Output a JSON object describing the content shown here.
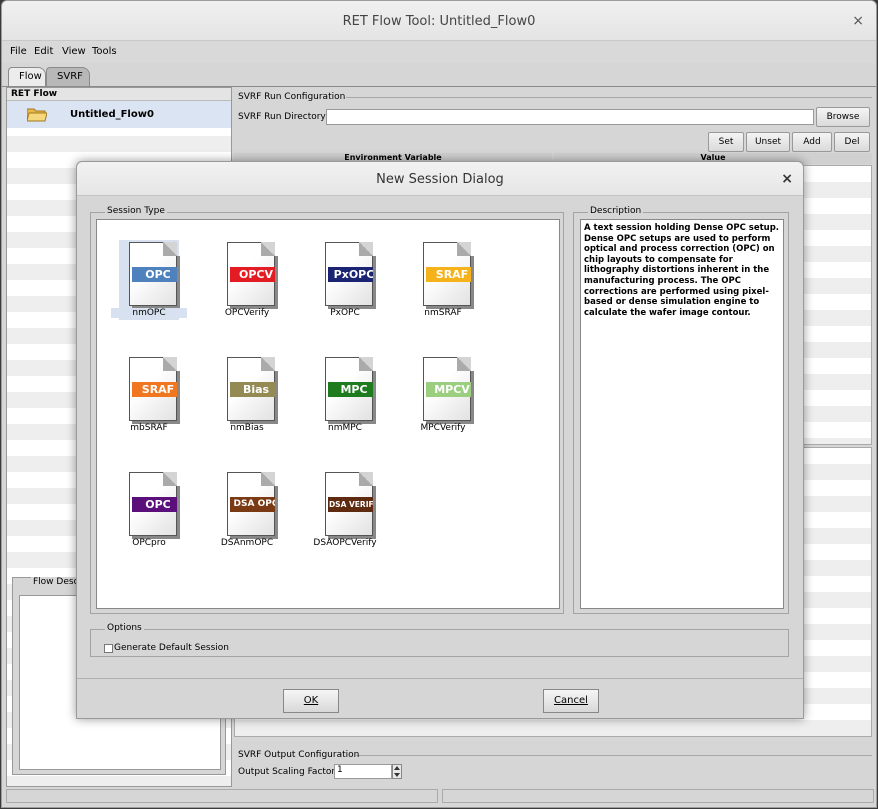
{
  "window": {
    "title": "RET Flow Tool: Untitled_Flow0",
    "close_glyph": "×"
  },
  "menu": [
    {
      "label": "File"
    },
    {
      "label": "Edit"
    },
    {
      "label": "View"
    },
    {
      "label": "Tools"
    }
  ],
  "tabs": [
    {
      "label": "Flow"
    },
    {
      "label": "SVRF"
    }
  ],
  "left": {
    "header": "RET Flow",
    "flow_item": "Untitled_Flow0",
    "flow_description_label": "Flow Descr"
  },
  "svrf_run": {
    "group_label": "SVRF Run Configuration",
    "directory_label": "SVRF Run Directory",
    "directory_value": "",
    "browse": "Browse",
    "buttons": [
      "Set",
      "Unset",
      "Add",
      "Del"
    ],
    "columns": [
      "Environment Variable",
      "Value"
    ]
  },
  "svrf_output": {
    "group_label": "SVRF Output Configuration",
    "scaling_label": "Output Scaling Factor",
    "scaling_value": "1"
  },
  "dialog": {
    "title": "New Session Dialog",
    "close_glyph": "×",
    "session_type_label": "Session Type",
    "description_label": "Description",
    "description": "A text session holding Dense OPC setup. Dense OPC setups are used to perform optical and process correction (OPC) on chip layouts to compensate for lithography distortions inherent in the manufacturing process. The OPC corrections are performed using pixel-based or dense simulation engine to calculate the wafer image contour.",
    "options_label": "Options",
    "generate_default": "Generate Default Session",
    "ok": "OK",
    "cancel": "Cancel",
    "sessions": [
      {
        "band": "OPC",
        "name": "nmOPC",
        "color": "#4f81bd",
        "selected": true
      },
      {
        "band": "OPCV",
        "name": "OPCVerify",
        "color": "#e31b23"
      },
      {
        "band": "PxOPC",
        "name": "PxOPC",
        "color": "#1a2472"
      },
      {
        "band": "SRAF",
        "name": "nmSRAF",
        "color": "#f5b21b"
      },
      {
        "band": "SRAF",
        "name": "mbSRAF",
        "color": "#f07620"
      },
      {
        "band": "Bias",
        "name": "nmBias",
        "color": "#948a54"
      },
      {
        "band": "MPC",
        "name": "nmMPC",
        "color": "#1e7b1e"
      },
      {
        "band": "MPCV",
        "name": "MPCVerify",
        "color": "#9bcf7f"
      },
      {
        "band": "OPC",
        "name": "OPCpro",
        "color": "#5a0f7a"
      },
      {
        "band": "DSA OPC",
        "name": "DSAnmOPC",
        "color": "#7a3a14"
      },
      {
        "band": "DSA VERIFY",
        "name": "DSAOPCVerify",
        "color": "#5e2a10"
      }
    ]
  }
}
